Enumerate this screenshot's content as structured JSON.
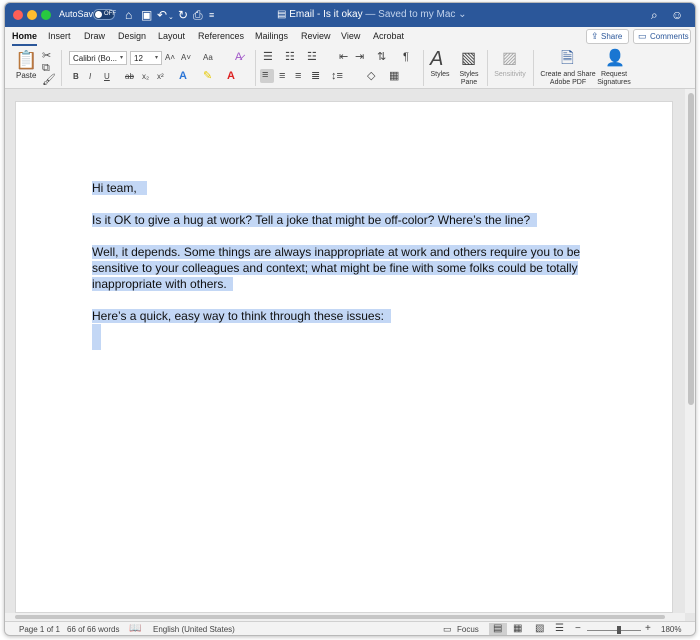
{
  "titlebar": {
    "autosave_label": "AutoSave",
    "autosave_state": "OFF",
    "doc_name": "Email - Is it okay",
    "saved_status": "— Saved to my Mac ⌄"
  },
  "tabs": [
    {
      "label": "Home",
      "active": true
    },
    {
      "label": "Insert"
    },
    {
      "label": "Draw"
    },
    {
      "label": "Design"
    },
    {
      "label": "Layout"
    },
    {
      "label": "References"
    },
    {
      "label": "Mailings"
    },
    {
      "label": "Review"
    },
    {
      "label": "View"
    },
    {
      "label": "Acrobat"
    }
  ],
  "header_buttons": {
    "share": "Share",
    "comments": "Comments"
  },
  "ribbon": {
    "paste_label": "Paste",
    "font_name": "Calibri (Bo...",
    "font_size": "12",
    "styles_label": "Styles",
    "styles_pane_label": "Styles Pane",
    "sensitivity_label": "Sensitivity",
    "create_pdf_label": "Create and Share Adobe PDF",
    "request_sig_label": "Request Signatures",
    "format_glyphs": {
      "bold": "B",
      "italic": "I",
      "underline": "U",
      "strike": "ab",
      "sub": "x₂",
      "sup": "x²",
      "grow": "A˄",
      "shrink": "A˅",
      "case": "Aa",
      "pilcrow": "¶"
    }
  },
  "document": {
    "paragraphs": [
      "Hi team,",
      "Is it OK to give a hug at work? Tell a joke that might be off-color? Where’s the line?",
      "Well, it depends. Some things are always inappropriate at work and others require you to be sensitive to your colleagues and context; what might be fine with some folks could be totally inappropriate with others.",
      "Here’s a quick, easy way to think through these issues:"
    ],
    "selection_color": "#c3d7f5"
  },
  "statusbar": {
    "page": "Page 1 of 1",
    "words": "66 of 66 words",
    "language": "English (United States)",
    "focus": "Focus",
    "zoom": "180%"
  },
  "colors": {
    "accent": "#2b579a"
  }
}
